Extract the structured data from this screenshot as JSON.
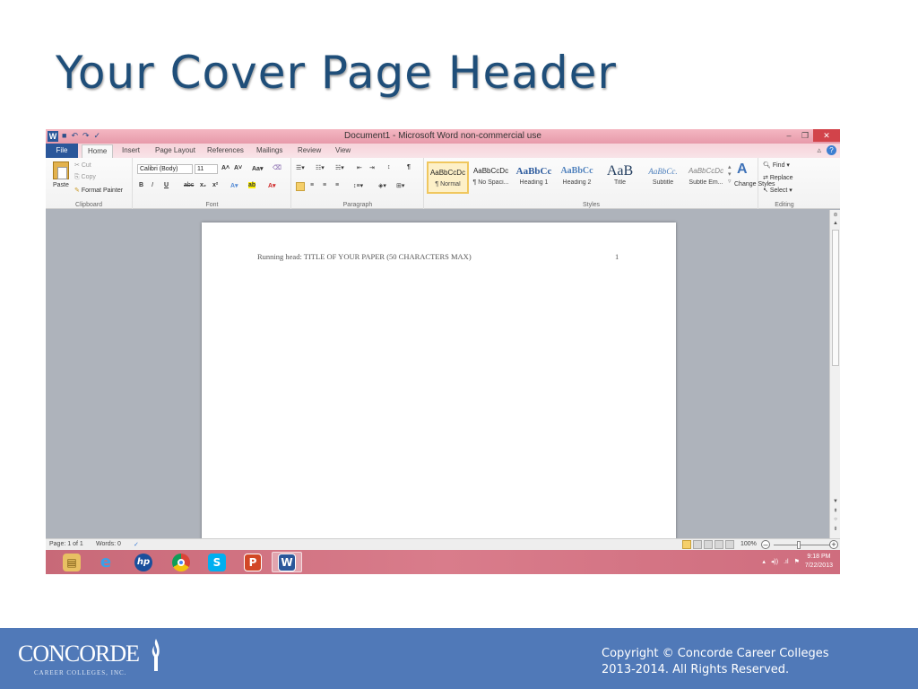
{
  "slide": {
    "title": "Your Cover Page Header"
  },
  "word": {
    "window_title": "Document1 - Microsoft Word non-commercial use",
    "tabs": [
      {
        "label": "File"
      },
      {
        "label": "Home"
      },
      {
        "label": "Insert"
      },
      {
        "label": "Page Layout"
      },
      {
        "label": "References"
      },
      {
        "label": "Mailings"
      },
      {
        "label": "Review"
      },
      {
        "label": "View"
      }
    ],
    "clipboard": {
      "paste": "Paste",
      "cut": "Cut",
      "copy": "Copy",
      "format_painter": "Format Painter",
      "group_label": "Clipboard"
    },
    "font": {
      "font_name": "Calibri (Body)",
      "font_size": "11",
      "group_label": "Font"
    },
    "paragraph": {
      "group_label": "Paragraph"
    },
    "styles": {
      "items": [
        {
          "sample": "AaBbCcDc",
          "name": "¶ Normal"
        },
        {
          "sample": "AaBbCcDc",
          "name": "¶ No Spaci..."
        },
        {
          "sample": "AaBbCc",
          "name": "Heading 1"
        },
        {
          "sample": "AaBbCc",
          "name": "Heading 2"
        },
        {
          "sample": "AaB",
          "name": "Title"
        },
        {
          "sample": "AaBbCc.",
          "name": "Subtitle"
        },
        {
          "sample": "AaBbCcDc",
          "name": "Subtle Em..."
        }
      ],
      "change_styles": "Change Styles",
      "group_label": "Styles"
    },
    "editing": {
      "find": "Find",
      "replace": "Replace",
      "select": "Select",
      "group_label": "Editing"
    },
    "document": {
      "running_head": "Running head: TITLE OF YOUR PAPER (50 CHARACTERS MAX)",
      "page_number": "1"
    },
    "status": {
      "page": "Page: 1 of 1",
      "words": "Words: 0",
      "zoom": "100%"
    },
    "taskbar": {
      "time": "9:18 PM",
      "date": "7/22/2013"
    }
  },
  "footer": {
    "logo_text": "CONCORDE",
    "logo_subtext": "CAREER COLLEGES, INC.",
    "copyright_line1": "Copyright © Concorde Career Colleges",
    "copyright_line2": "2013-2014. All Rights Reserved."
  },
  "colors": {
    "title": "#1f4e79",
    "footer_bg": "#5079b8",
    "word_blue": "#2b579a",
    "taskbar": "#d97c8b"
  }
}
